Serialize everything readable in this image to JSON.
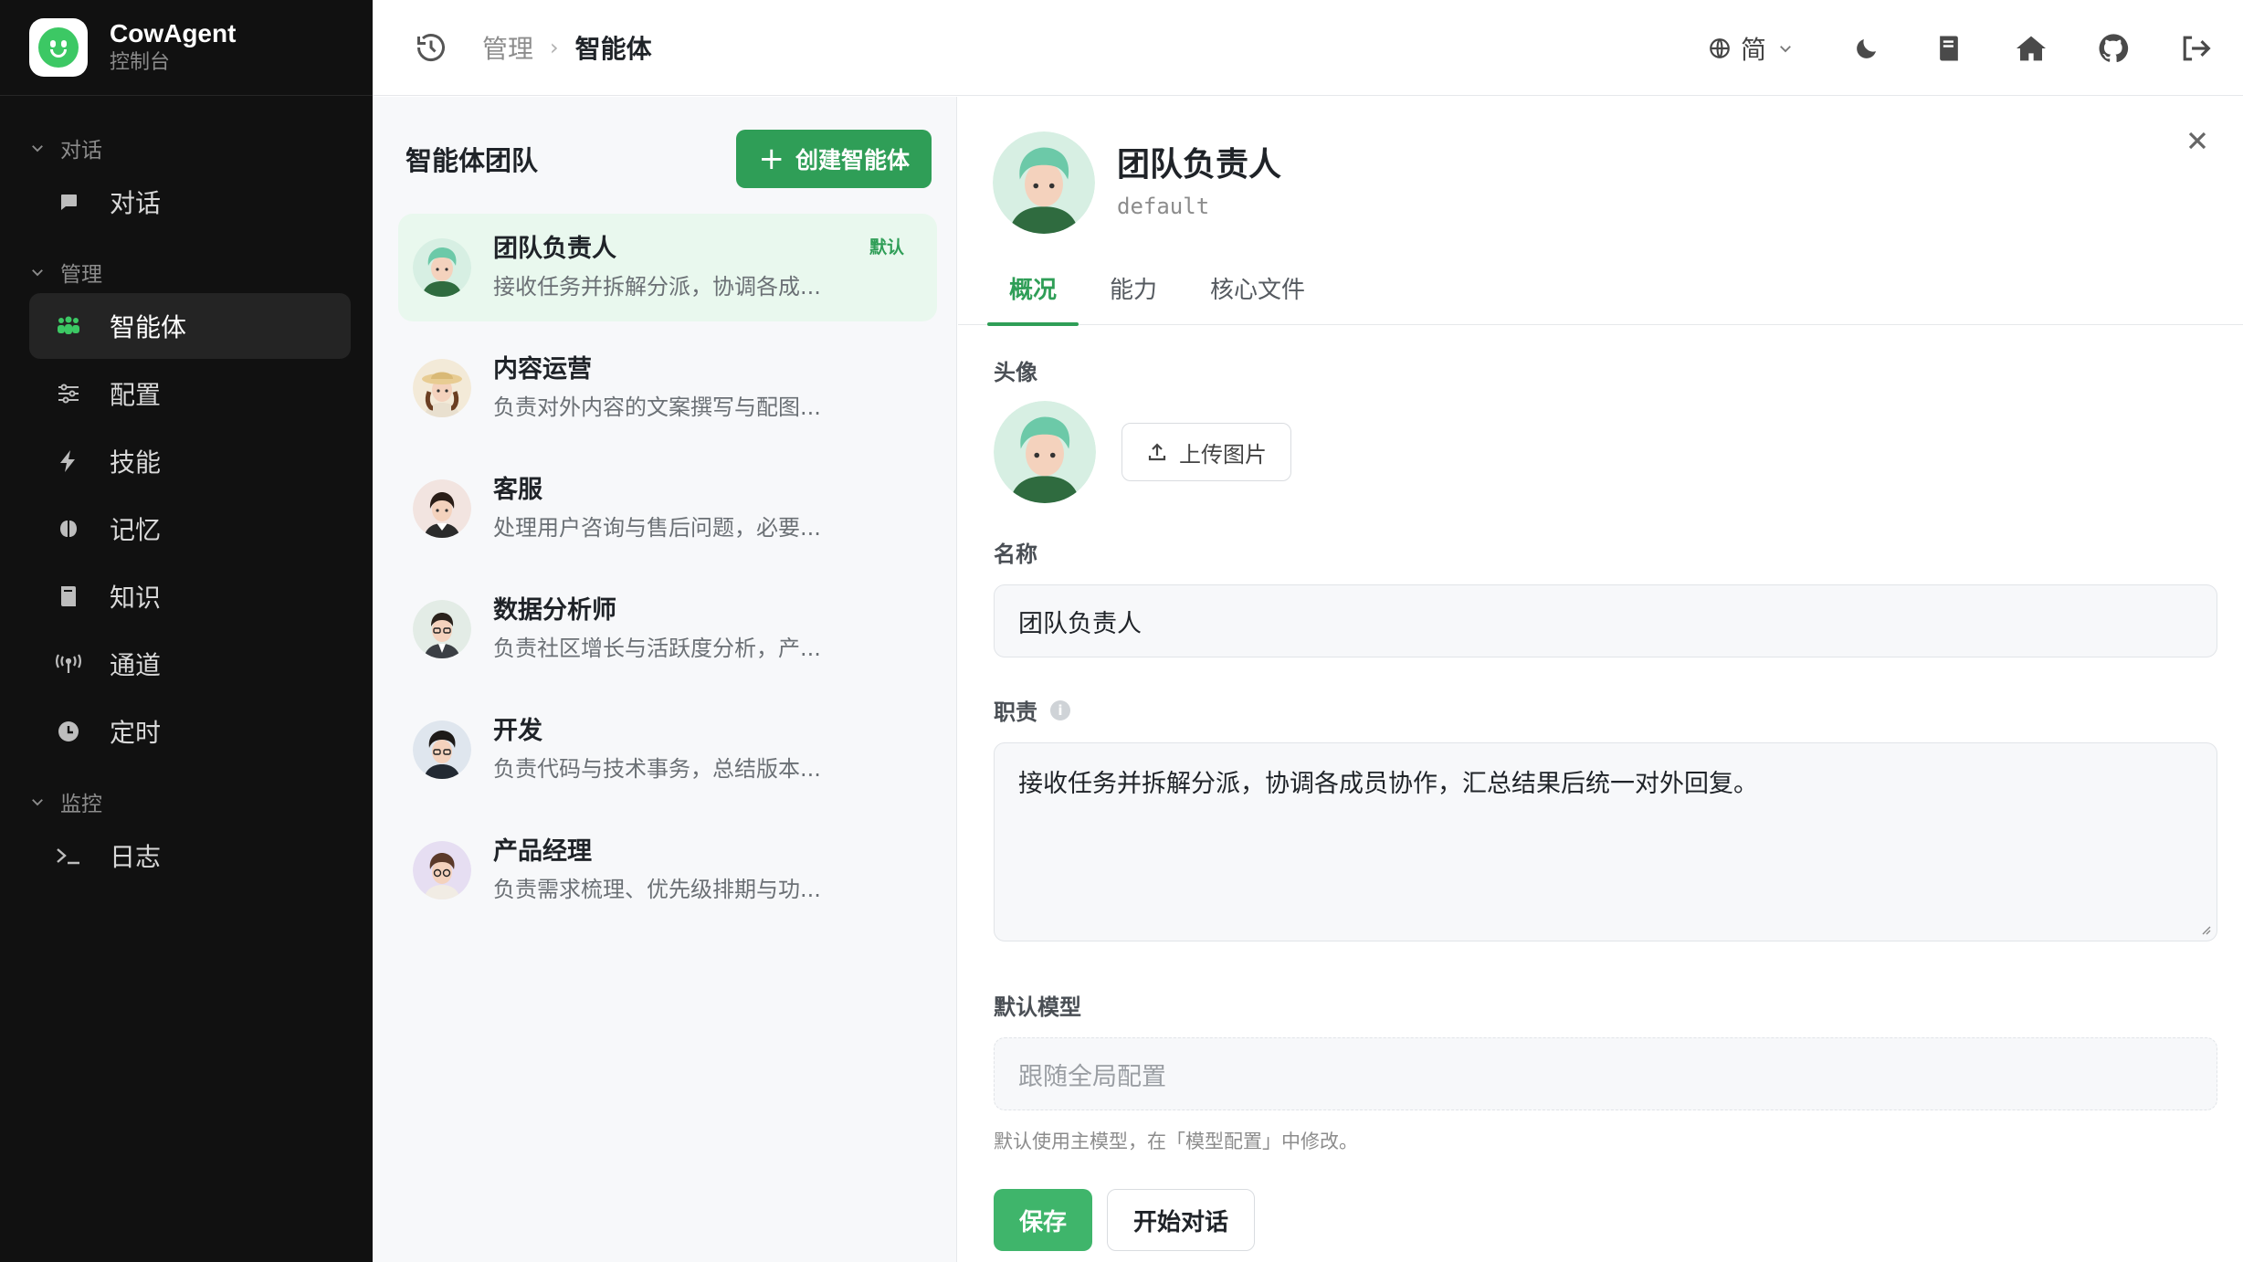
{
  "brand": {
    "title": "CowAgent",
    "subtitle": "控制台"
  },
  "sidebar": {
    "groups": [
      {
        "label": "对话",
        "items": [
          {
            "label": "对话",
            "icon": "chat-bubble-icon"
          }
        ]
      },
      {
        "label": "管理",
        "items": [
          {
            "label": "智能体",
            "icon": "team-icon",
            "active": true
          },
          {
            "label": "配置",
            "icon": "sliders-icon"
          },
          {
            "label": "技能",
            "icon": "lightning-icon"
          },
          {
            "label": "记忆",
            "icon": "brain-icon"
          },
          {
            "label": "知识",
            "icon": "book-icon"
          },
          {
            "label": "通道",
            "icon": "antenna-icon"
          },
          {
            "label": "定时",
            "icon": "clock-icon"
          }
        ]
      },
      {
        "label": "监控",
        "items": [
          {
            "label": "日志",
            "icon": "terminal-icon"
          }
        ]
      }
    ]
  },
  "topbar": {
    "breadcrumb": [
      "管理",
      "智能体"
    ],
    "lang_label": "简"
  },
  "list": {
    "title": "智能体团队",
    "create_label": "创建智能体",
    "agents": [
      {
        "name": "团队负责人",
        "desc": "接收任务并拆解分派，协调各成...",
        "badge": "默认",
        "selected": true
      },
      {
        "name": "内容运营",
        "desc": "负责对外内容的文案撰写与配图..."
      },
      {
        "name": "客服",
        "desc": "处理用户咨询与售后问题，必要..."
      },
      {
        "name": "数据分析师",
        "desc": "负责社区增长与活跃度分析，产..."
      },
      {
        "name": "开发",
        "desc": "负责代码与技术事务，总结版本..."
      },
      {
        "name": "产品经理",
        "desc": "负责需求梳理、优先级排期与功..."
      }
    ]
  },
  "detail": {
    "name": "团队负责人",
    "id": "default",
    "tabs": [
      "概况",
      "能力",
      "核心文件"
    ],
    "avatar_label": "头像",
    "upload_label": "上传图片",
    "name_label": "名称",
    "name_value": "团队负责人",
    "duty_label": "职责",
    "duty_value": "接收任务并拆解分派，协调各成员协作，汇总结果后统一对外回复。",
    "model_label": "默认模型",
    "model_placeholder": "跟随全局配置",
    "model_hint": "默认使用主模型，在「模型配置」中修改。",
    "save_label": "保存",
    "chat_label": "开始对话"
  },
  "colors": {
    "accent": "#2f9e57",
    "sidebar_bg": "#111111",
    "selected_bg": "#e9f8ee"
  }
}
